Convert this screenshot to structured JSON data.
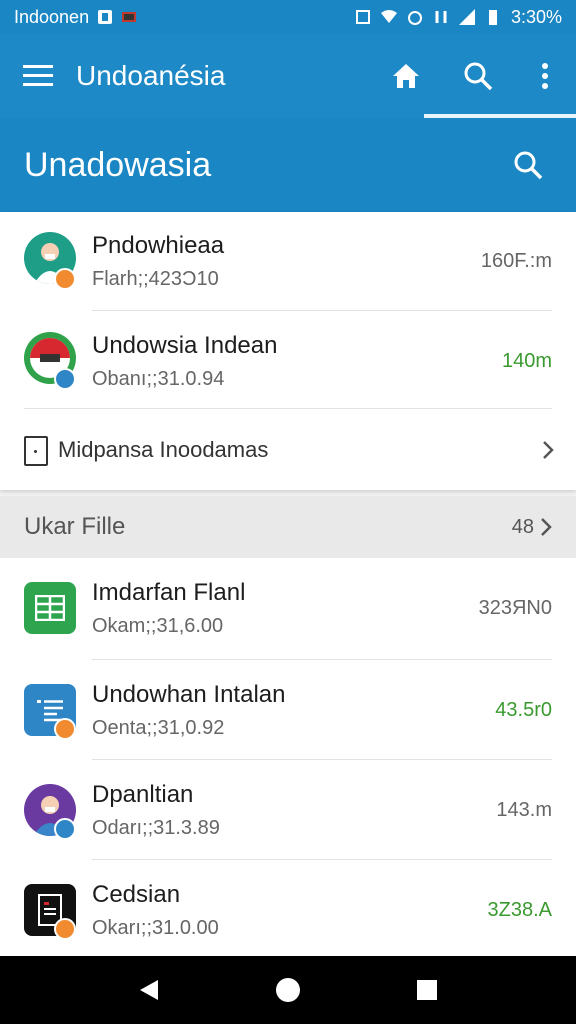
{
  "status_bar": {
    "carrier": "Indoonen",
    "time": "3:30%"
  },
  "app_bar": {
    "title": "Undoanésia",
    "icons": [
      "menu-icon",
      "home-icon",
      "search-icon",
      "more-vert-icon"
    ]
  },
  "search_banner": {
    "title": "Unadowasia",
    "icon": "search-icon"
  },
  "top_items": [
    {
      "name": "Pndowhieaa",
      "sub": "Flarh;;423Ɔ10",
      "meta": "160F.:m",
      "meta_color": "gray"
    },
    {
      "name": "Undowsia Indean",
      "sub": "Obanı;;31.0.94",
      "meta": "140m",
      "meta_color": "green"
    }
  ],
  "link_row": {
    "label": "Midpansa Inoodamas"
  },
  "section": {
    "label": "Ukar Fille",
    "count": "48"
  },
  "files": [
    {
      "name": "Imdarfan Flanl",
      "sub": "Okam;;31,6.00",
      "meta": "323ЯN0",
      "meta_color": "gray",
      "icon": "spreadsheet-icon",
      "icon_color": "#2ea44f"
    },
    {
      "name": "Undowhan Intalan",
      "sub": "Oenta;;31,0.92",
      "meta": "43.5r0",
      "meta_color": "green",
      "icon": "document-icon",
      "icon_color": "#2f86c7"
    },
    {
      "name": "Dpanltian",
      "sub": "Odarı;;31.3.89",
      "meta": "143.m",
      "meta_color": "gray",
      "icon": "person-avatar-icon",
      "icon_color": "#6a3aa0"
    },
    {
      "name": "Cedsian",
      "sub": "Okarı;;31.0.00",
      "meta": "3Z38.A",
      "meta_color": "green",
      "icon": "pdf-icon",
      "icon_color": "#111111"
    }
  ],
  "nav": {
    "icons": [
      "back-icon",
      "home-circle-icon",
      "recents-icon"
    ]
  },
  "colors": {
    "primary": "#1d89c6",
    "accent_orange": "#f28b30",
    "green_text": "#3a9a2f"
  }
}
